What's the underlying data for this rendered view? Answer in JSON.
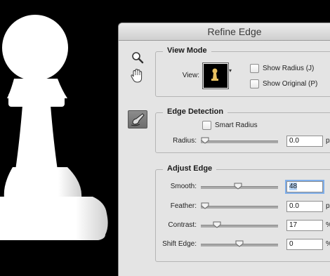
{
  "dialog": {
    "title": "Refine Edge"
  },
  "tools": {
    "zoom": "zoom-icon",
    "hand": "hand-icon",
    "refine_brush": "refine-radius-brush-icon"
  },
  "view_mode": {
    "title": "View Mode",
    "view_label": "View:",
    "show_radius": {
      "label": "Show Radius (J)",
      "checked": false
    },
    "show_original": {
      "label": "Show Original (P)",
      "checked": false
    }
  },
  "edge_detection": {
    "title": "Edge Detection",
    "smart_radius": {
      "label": "Smart Radius",
      "checked": false
    },
    "radius": {
      "label": "Radius:",
      "value": "0.0",
      "unit": "px",
      "level": 0.0
    }
  },
  "adjust_edge": {
    "title": "Adjust Edge",
    "smooth": {
      "label": "Smooth:",
      "value": "48",
      "level": 0.48
    },
    "feather": {
      "label": "Feather:",
      "value": "0.0",
      "unit": "px",
      "level": 0.0
    },
    "contrast": {
      "label": "Contrast:",
      "value": "17",
      "unit": "%",
      "level": 0.17
    },
    "shift_edge": {
      "label": "Shift Edge:",
      "value": "0",
      "unit": "%",
      "level": 0.5
    }
  },
  "colors": {
    "dialog_bg": "#e4e4e4",
    "canvas_bg": "#000000",
    "focus": "#7faeea"
  }
}
